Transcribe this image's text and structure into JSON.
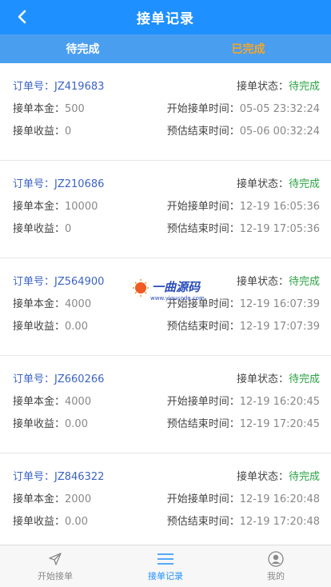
{
  "header": {
    "title": "接单记录"
  },
  "tabs": [
    {
      "label": "待完成"
    },
    {
      "label": "已完成"
    }
  ],
  "labels": {
    "order_no": "订单号：",
    "status": "接单状态：",
    "principal": "接单本金：",
    "start_time": "开始接单时间：",
    "income": "接单收益：",
    "end_time": "预估结束时间："
  },
  "orders": [
    {
      "order_no": "JZ419683",
      "status": "待完成",
      "principal": "500",
      "start_time": "05-05 23:32:24",
      "income": "0",
      "end_time": "05-06 00:32:24"
    },
    {
      "order_no": "JZ210686",
      "status": "待完成",
      "principal": "10000",
      "start_time": "12-19 16:05:36",
      "income": "0",
      "end_time": "12-19 17:05:36"
    },
    {
      "order_no": "JZ564900",
      "status": "待完成",
      "principal": "4000",
      "start_time": "12-19 16:07:39",
      "income": "0.00",
      "end_time": "12-19 17:07:39"
    },
    {
      "order_no": "JZ660266",
      "status": "待完成",
      "principal": "4000",
      "start_time": "12-19 16:20:45",
      "income": "0.00",
      "end_time": "12-19 17:20:45"
    },
    {
      "order_no": "JZ846322",
      "status": "待完成",
      "principal": "2000",
      "start_time": "12-19 16:20:48",
      "income": "0.00",
      "end_time": "12-19 17:20:48"
    }
  ],
  "watermark": {
    "text": "一曲源码",
    "url_text": "www.yiqucode.com"
  },
  "tabbar": [
    {
      "label": "开始接单",
      "icon": "send-icon"
    },
    {
      "label": "接单记录",
      "icon": "list-icon"
    },
    {
      "label": "我的",
      "icon": "user-icon"
    }
  ],
  "colors": {
    "header": "#1e90ff",
    "tabs_bg": "#4a9ef0",
    "tab_active": "#f5a623",
    "status": "#2ba244",
    "order_no": "#3b63c4"
  }
}
